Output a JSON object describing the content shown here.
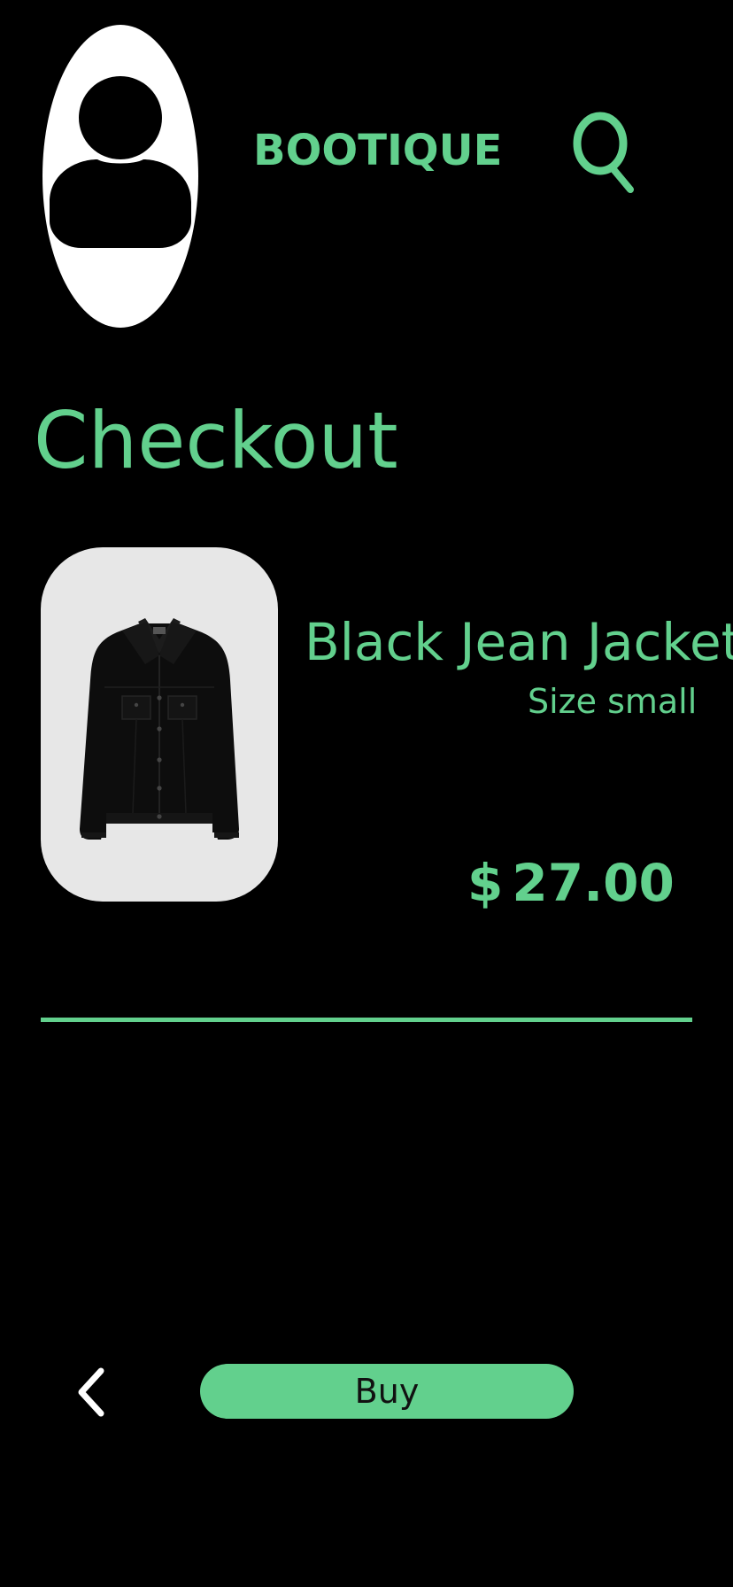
{
  "theme": {
    "background": "#000000",
    "accent": "#62d08d",
    "card_background": "#e7e7e7",
    "button_text_color": "#111111"
  },
  "header": {
    "avatar_icon": "user-icon",
    "brand": "BOOTIQUE",
    "search_icon": "search-icon"
  },
  "page": {
    "title": "Checkout"
  },
  "cart": {
    "item": {
      "image_icon": "jacket-image",
      "name": "Black Jean Jacket",
      "size": "Size small",
      "currency_symbol": "$",
      "price": "27.00"
    }
  },
  "footer": {
    "back_icon": "chevron-left-icon",
    "buy_label": "Buy"
  }
}
